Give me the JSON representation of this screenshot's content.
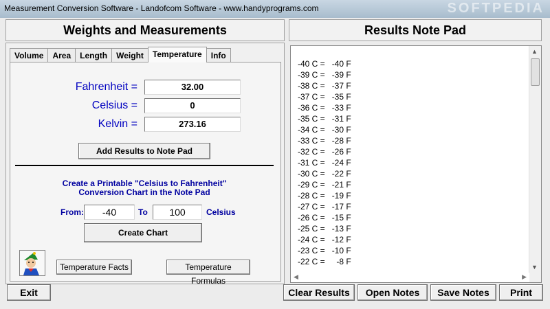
{
  "window": {
    "title": "Measurement Conversion Software - Landofcom Software - www.handyprograms.com",
    "watermark": "SOFTPEDIA"
  },
  "left": {
    "header": "Weights and Measurements",
    "tabs": [
      "Volume",
      "Area",
      "Length",
      "Weight",
      "Temperature",
      "Info"
    ],
    "active_tab": "Temperature",
    "fahrenheit_label": "Fahrenheit =",
    "fahrenheit_value": "32.00",
    "celsius_label": "Celsius =",
    "celsius_value": "0",
    "kelvin_label": "Kelvin =",
    "kelvin_value": "273.16",
    "add_results_label": "Add Results to Note Pad",
    "chart_heading_1": "Create a Printable \"Celsius to Fahrenheit\"",
    "chart_heading_2": "Conversion Chart in the Note Pad",
    "from_label": "From:",
    "from_value": "-40",
    "to_label": "To",
    "to_value": "100",
    "unit_label": "Celsius",
    "create_chart_label": "Create Chart",
    "facts_label": "Temperature Facts",
    "formulas_label": "Temperature Formulas"
  },
  "right": {
    "header": "Results Note Pad",
    "notes": [
      "-40 C =   -40 F",
      "-39 C =   -39 F",
      "-38 C =   -37 F",
      "-37 C =   -35 F",
      "-36 C =   -33 F",
      "-35 C =   -31 F",
      "-34 C =   -30 F",
      "-33 C =   -28 F",
      "-32 C =   -26 F",
      "-31 C =   -24 F",
      "-30 C =   -22 F",
      "-29 C =   -21 F",
      "-28 C =   -19 F",
      "-27 C =   -17 F",
      "-26 C =   -15 F",
      "-25 C =   -13 F",
      "-24 C =   -12 F",
      "-23 C =   -10 F",
      "-22 C =     -8 F"
    ]
  },
  "buttons": {
    "exit": "Exit",
    "clear": "Clear Results",
    "open": "Open Notes",
    "save": "Save Notes",
    "print": "Print"
  }
}
